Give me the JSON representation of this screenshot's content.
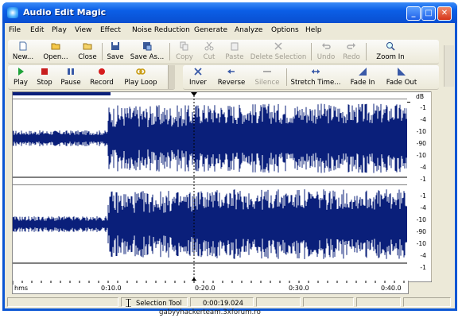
{
  "window": {
    "title": "Audio Edit Magic",
    "min": "_",
    "max": "□",
    "close": "✕"
  },
  "menu": [
    "File",
    "Edit",
    "Play",
    "View",
    "Effect",
    "Noise Reduction",
    "Generate",
    "Analyze",
    "Options",
    "Help"
  ],
  "toolbar1": {
    "new": "New...",
    "open": "Open...",
    "close": "Close",
    "save": "Save",
    "save_as": "Save As...",
    "copy": "Copy",
    "cut": "Cut",
    "paste": "Paste",
    "delete_selection": "Delete Selection",
    "undo": "Undo",
    "redo": "Redo",
    "zoom_in": "Zoom In"
  },
  "toolbar2": {
    "play": "Play",
    "stop": "Stop",
    "pause": "Pause",
    "record": "Record",
    "play_loop": "Play Loop",
    "invert": "Inver",
    "reverse": "Reverse",
    "silence": "Silence",
    "stretch_time": "Stretch Time...",
    "fade_in": "Fade In",
    "fade_out": "Fade Out"
  },
  "scale": {
    "unit": "dB",
    "channel1": [
      "-1",
      "-4",
      "-10",
      "-90",
      "-10",
      "-4",
      "-1"
    ],
    "channel2": [
      "-1",
      "-4",
      "-10",
      "-90",
      "-10",
      "-4",
      "-1"
    ]
  },
  "timeline": {
    "unit": "hms",
    "labels": [
      "0:10.0",
      "0:20.0",
      "0:30.0",
      "0:40.0"
    ]
  },
  "status": {
    "tool": "Selection Tool",
    "time": "0:00:19.024"
  },
  "watermark": "gabyyhackerteam.3xforum.ro",
  "colors": {
    "waveform": "#0a1f7a",
    "title_bar": "#0b56d4"
  }
}
